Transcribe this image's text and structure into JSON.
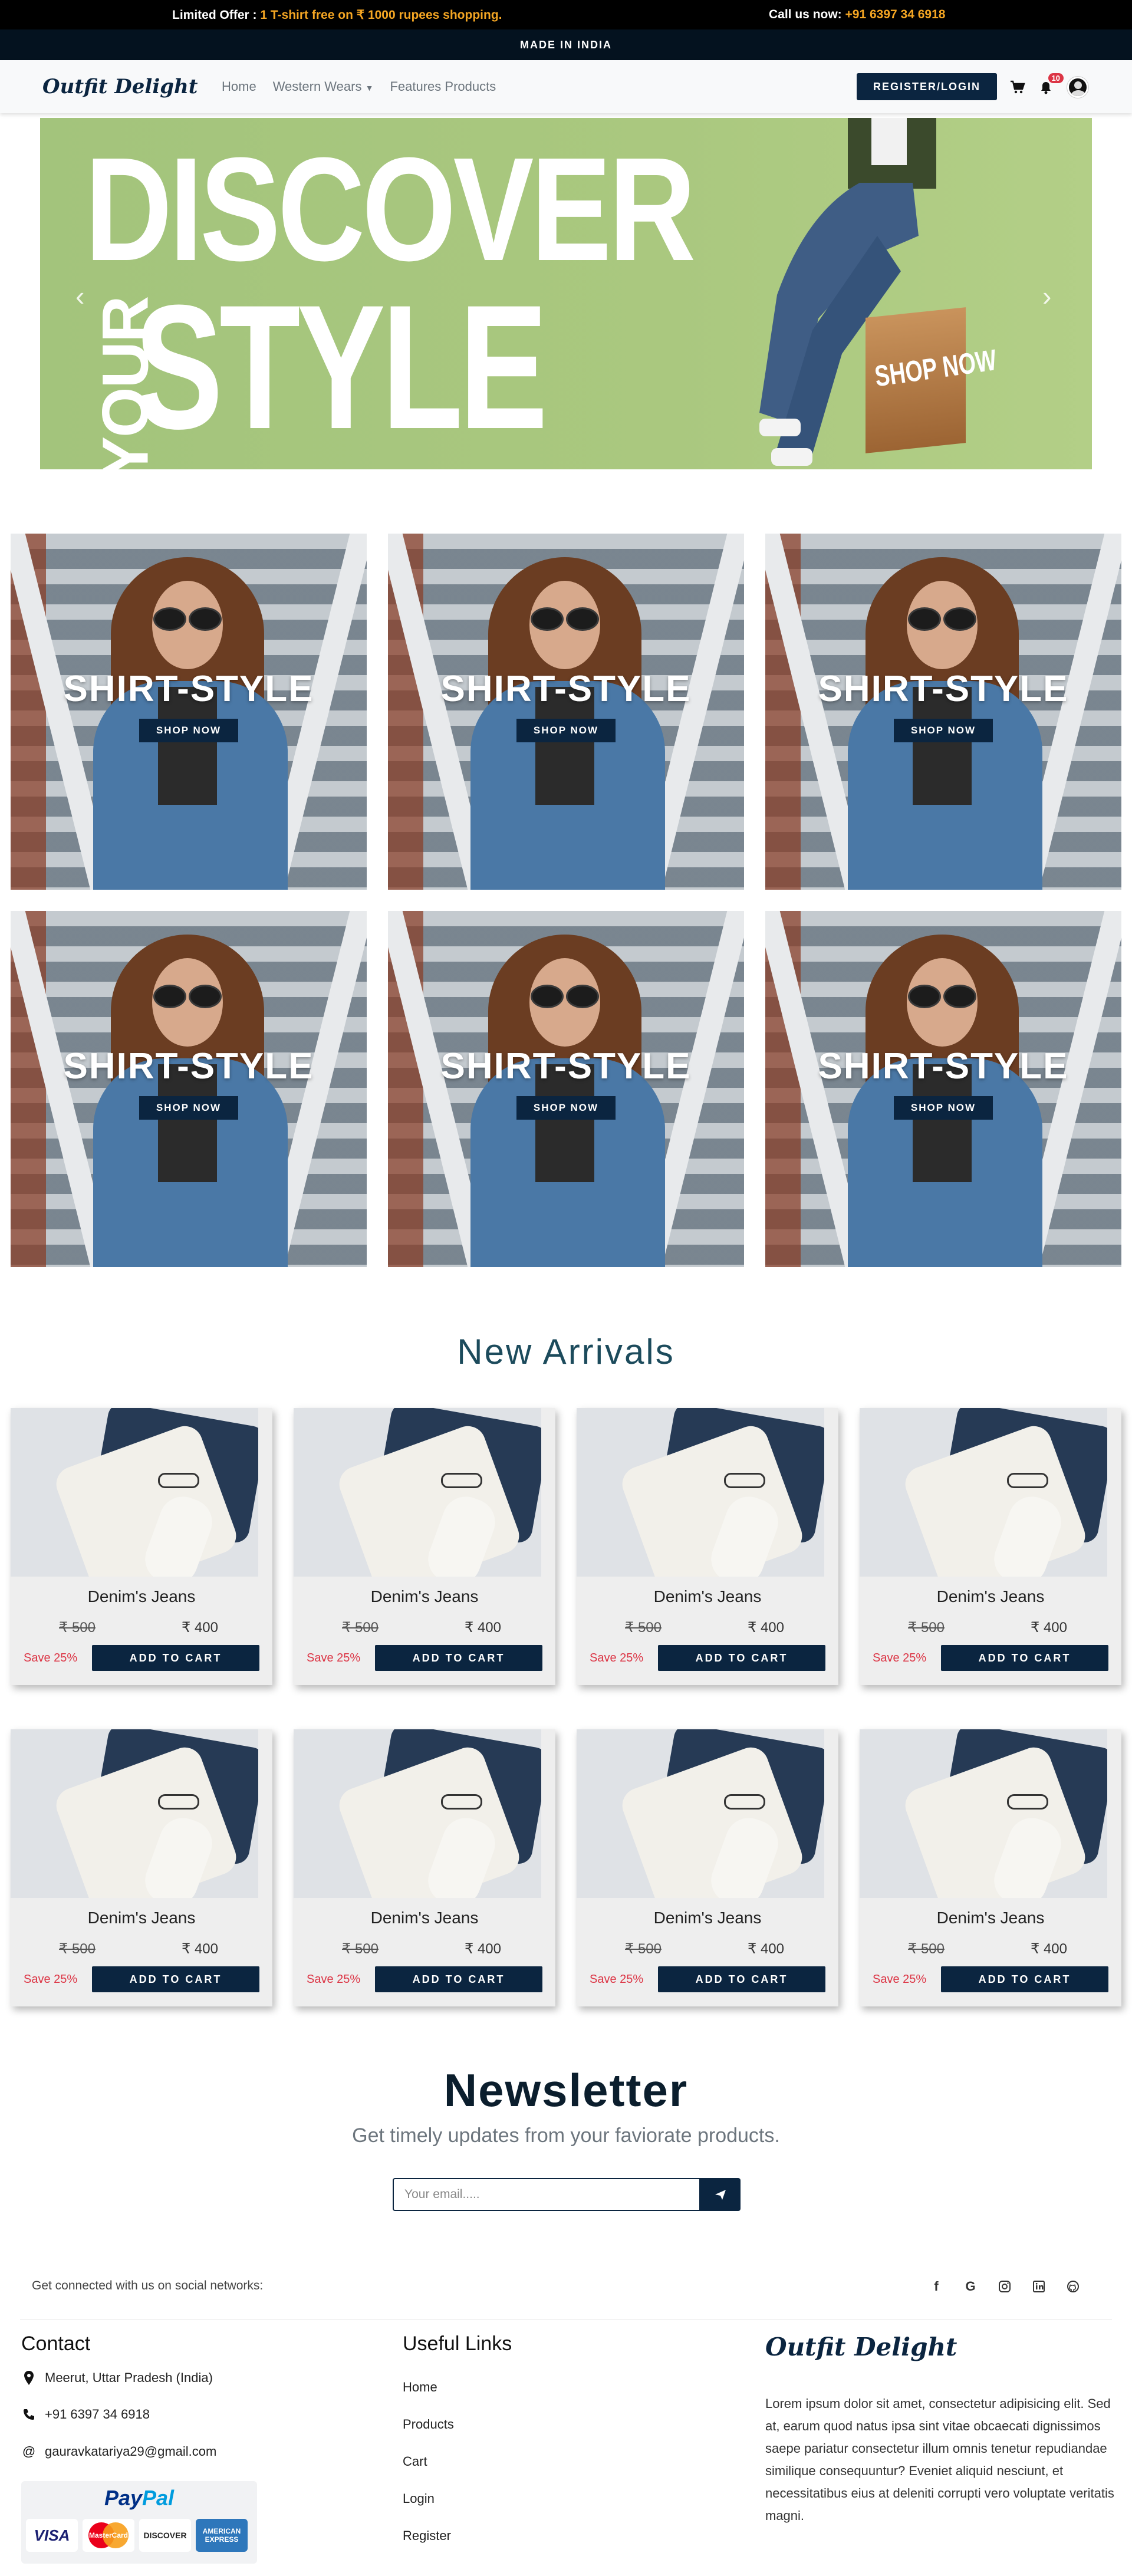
{
  "topbar": {
    "offer_label": "Limited Offer :",
    "offer_text": "1 T-shirt free on ₹ 1000 rupees shopping.",
    "call_label": "Call us now:",
    "phone": "+91 6397 34 6918"
  },
  "made_in": "MADE IN INDIA",
  "nav": {
    "brand": "Outfit Delight",
    "links": [
      "Home",
      "Western Wears",
      "Features Products"
    ],
    "register_label": "REGISTER/LOGIN",
    "notification_count": "10"
  },
  "hero": {
    "line1": "DISCOVER",
    "line2_small": "YOUR",
    "line2_big": "STYLE",
    "shop": "SHOP NOW"
  },
  "promos": [
    {
      "title": "SHIRT-STYLE",
      "button": "SHOP NOW"
    },
    {
      "title": "SHIRT-STYLE",
      "button": "SHOP NOW"
    },
    {
      "title": "SHIRT-STYLE",
      "button": "SHOP NOW"
    },
    {
      "title": "SHIRT-STYLE",
      "button": "SHOP NOW"
    },
    {
      "title": "SHIRT-STYLE",
      "button": "SHOP NOW"
    },
    {
      "title": "SHIRT-STYLE",
      "button": "SHOP NOW"
    }
  ],
  "arrivals": {
    "title": "New Arrivals",
    "products": [
      {
        "name": "Denim's Jeans",
        "old_price": "₹ 500",
        "price": "₹ 400",
        "save": "Save 25%",
        "button": "ADD TO CART"
      },
      {
        "name": "Denim's Jeans",
        "old_price": "₹ 500",
        "price": "₹ 400",
        "save": "Save 25%",
        "button": "ADD TO CART"
      },
      {
        "name": "Denim's Jeans",
        "old_price": "₹ 500",
        "price": "₹ 400",
        "save": "Save 25%",
        "button": "ADD TO CART"
      },
      {
        "name": "Denim's Jeans",
        "old_price": "₹ 500",
        "price": "₹ 400",
        "save": "Save 25%",
        "button": "ADD TO CART"
      },
      {
        "name": "Denim's Jeans",
        "old_price": "₹ 500",
        "price": "₹ 400",
        "save": "Save 25%",
        "button": "ADD TO CART"
      },
      {
        "name": "Denim's Jeans",
        "old_price": "₹ 500",
        "price": "₹ 400",
        "save": "Save 25%",
        "button": "ADD TO CART"
      },
      {
        "name": "Denim's Jeans",
        "old_price": "₹ 500",
        "price": "₹ 400",
        "save": "Save 25%",
        "button": "ADD TO CART"
      },
      {
        "name": "Denim's Jeans",
        "old_price": "₹ 500",
        "price": "₹ 400",
        "save": "Save 25%",
        "button": "ADD TO CART"
      }
    ]
  },
  "newsletter": {
    "title": "Newsletter",
    "subtitle": "Get timely updates from your faviorate products.",
    "placeholder": "Your email....."
  },
  "social": {
    "text": "Get connected with us on social networks:",
    "icons": [
      "facebook-icon",
      "google-icon",
      "instagram-icon",
      "linkedin-icon",
      "github-icon"
    ]
  },
  "footer": {
    "contact_title": "Contact",
    "address": "Meerut, Uttar Pradesh (India)",
    "phone": "+91 6397 34 6918",
    "email": "gauravkatariya29@gmail.com",
    "links_title": "Useful Links",
    "links": [
      "Home",
      "Products",
      "Cart",
      "Login",
      "Register"
    ],
    "brand": "Outfit Delight",
    "about": "Lorem ipsum dolor sit amet, consectetur adipisicing elit. Sed at, earum quod natus ipsa sint vitae obcaecati dignissimos saepe pariatur consectetur illum omnis tenetur repudiandae similique consequuntur? Eveniet aliquid nesciunt, et necessitatibus eius at deleniti corrupti vero voluptate veritatis magni.",
    "payment": {
      "paypal_a": "Pay",
      "paypal_b": "Pal",
      "cards": [
        "VISA",
        "MasterCard",
        "DISCOVER",
        "AMERICAN EXPRESS"
      ]
    }
  },
  "colors": {
    "accent": "#0b2540",
    "highlight": "#f5a623",
    "sale": "#dc3545",
    "hero_bg": "#a7c67d"
  }
}
